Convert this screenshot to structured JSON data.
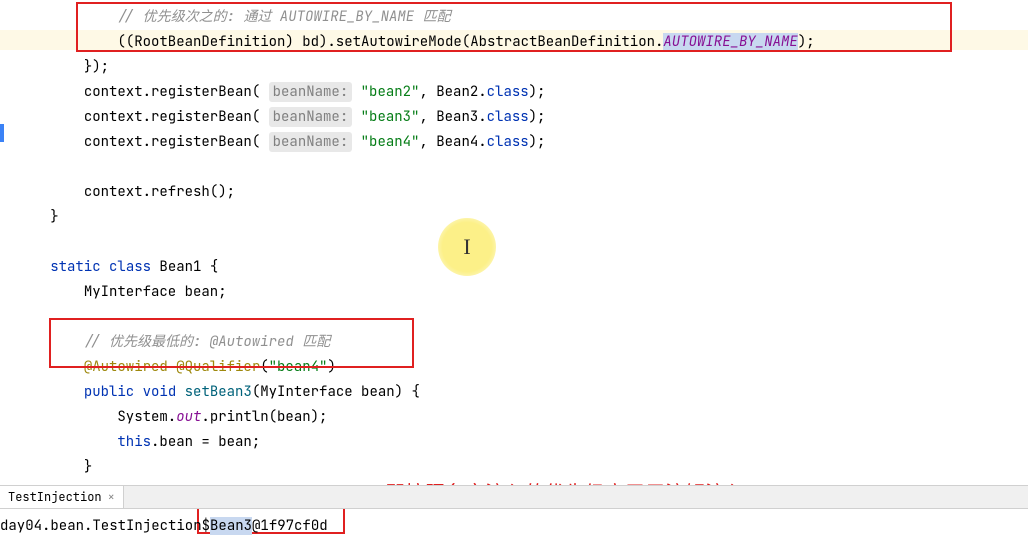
{
  "code": {
    "comment1": "// 优先级次之的: 通过 AUTOWIRE_BY_NAME 匹配",
    "line2_a": "((RootBeanDefinition) bd).setAutowireMode(AbstractBeanDefinition.",
    "line2_const": "AUTOWIRE_BY_NAME",
    "line2_b": ");",
    "line3": "});",
    "line4_a": "context.registerBean( ",
    "hint_beanname": "beanName:",
    "line4_b": " ",
    "str_bean2": "\"bean2\"",
    "line4_c": ", Bean2.",
    "kw_class": "class",
    "line4_d": ");",
    "str_bean3": "\"bean3\"",
    "line5_c": ", Bean3.",
    "str_bean4": "\"bean4\"",
    "line6_c": ", Bean4.",
    "line8": "context.refresh();",
    "line9": "}",
    "kw_static": "static",
    "kw_class2": "class",
    "line11_a": " Bean1 {",
    "line12": "MyInterface bean;",
    "comment2": "// 优先级最低的: @Autowired 匹配",
    "anno_autowired": "@Autowired",
    "anno_qualifier": "@Qualifier",
    "line15_a": "(",
    "str_bean4q": "\"bean4\"",
    "line15_b": ")",
    "kw_public": "public",
    "kw_void": "void",
    "method_setbean3": "setBean3",
    "line16_a": "(MyInterface bean) {",
    "line17_a": "System.",
    "static_out": "out",
    "line17_b": ".println(bean);",
    "kw_this": "this",
    "line18_a": ".bean = bean;",
    "line19": "}"
  },
  "tab": {
    "name": "TestInjection"
  },
  "console": {
    "prefix": "day04.bean.TestInjection",
    "dollar": "$",
    "highlighted": "Bean3",
    "suffix": "@1f97cf0d"
  },
  "annotation": {
    "text": "即按照名字注入的优先级高于用注解注入"
  }
}
